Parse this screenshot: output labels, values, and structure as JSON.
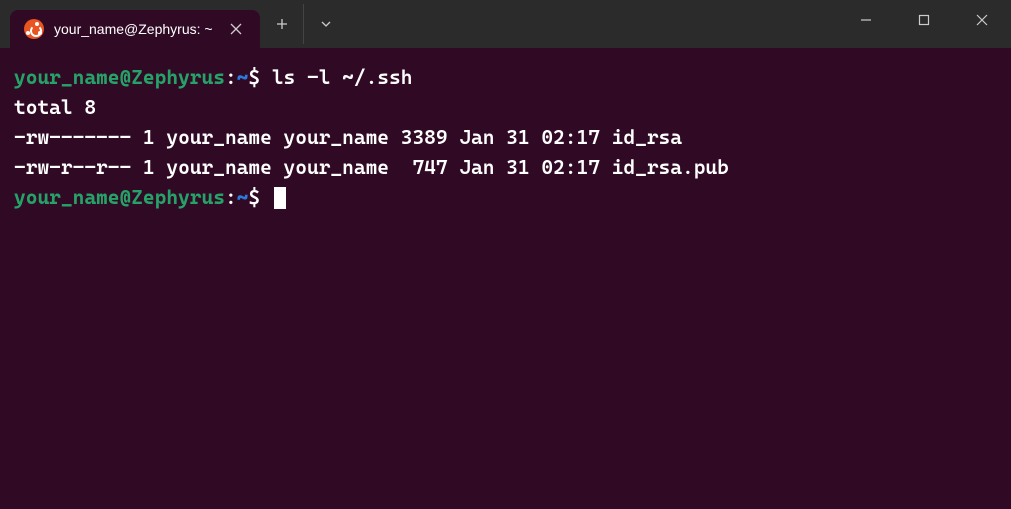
{
  "window": {
    "tab_title": "your_name@Zephyrus: ~"
  },
  "prompt": {
    "user_host": "your_name@Zephyrus",
    "sep1": ":",
    "path": "~",
    "sep2": "$ "
  },
  "session": {
    "command1": "ls -l ~/.ssh",
    "out_line1": "total 8",
    "out_line2": "-rw------- 1 your_name your_name 3389 Jan 31 02:17 id_rsa",
    "out_line3": "-rw-r--r-- 1 your_name your_name  747 Jan 31 02:17 id_rsa.pub"
  }
}
